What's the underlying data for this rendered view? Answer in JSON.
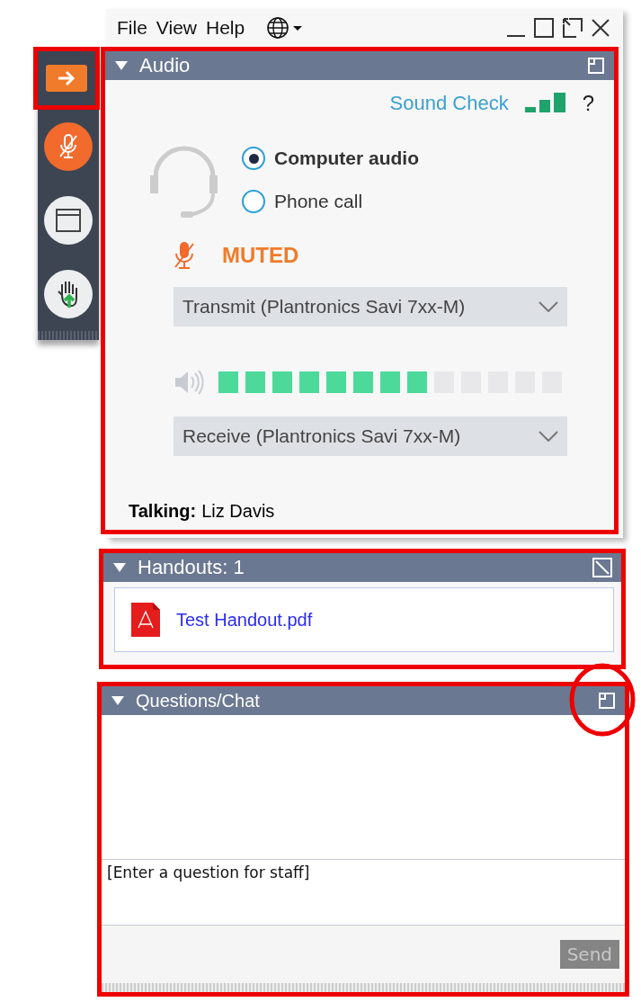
{
  "menu": [
    "File",
    "View",
    "Help"
  ],
  "sidebar": [
    {
      "kind": "arrow"
    },
    {
      "kind": "mic"
    },
    {
      "kind": "window"
    },
    {
      "kind": "hand"
    }
  ],
  "audio": {
    "title": "Audio",
    "expanded": true,
    "sound_check": "Sound Check",
    "help": "?",
    "options": [
      {
        "label": "Computer audio",
        "selected": true
      },
      {
        "label": "Phone call",
        "selected": false
      }
    ],
    "muted": true,
    "mute_label": "MUTED",
    "transmit": "Transmit (Plantronics Savi 7xx-M)",
    "speaker": {
      "level": 0.62
    },
    "receive": "Receive (Plantronics Savi 7xx-M)",
    "talking_label": "Talking:",
    "talking_name": "Liz Davis"
  },
  "handouts": {
    "title": "Handouts: 1",
    "expanded": true,
    "files": [
      "Test Handout.pdf"
    ]
  },
  "chat": {
    "title": "Questions/Chat",
    "expanded": true,
    "placeholder": "[Enter a question for staff]",
    "send": "Send",
    "send_disabled": true
  }
}
